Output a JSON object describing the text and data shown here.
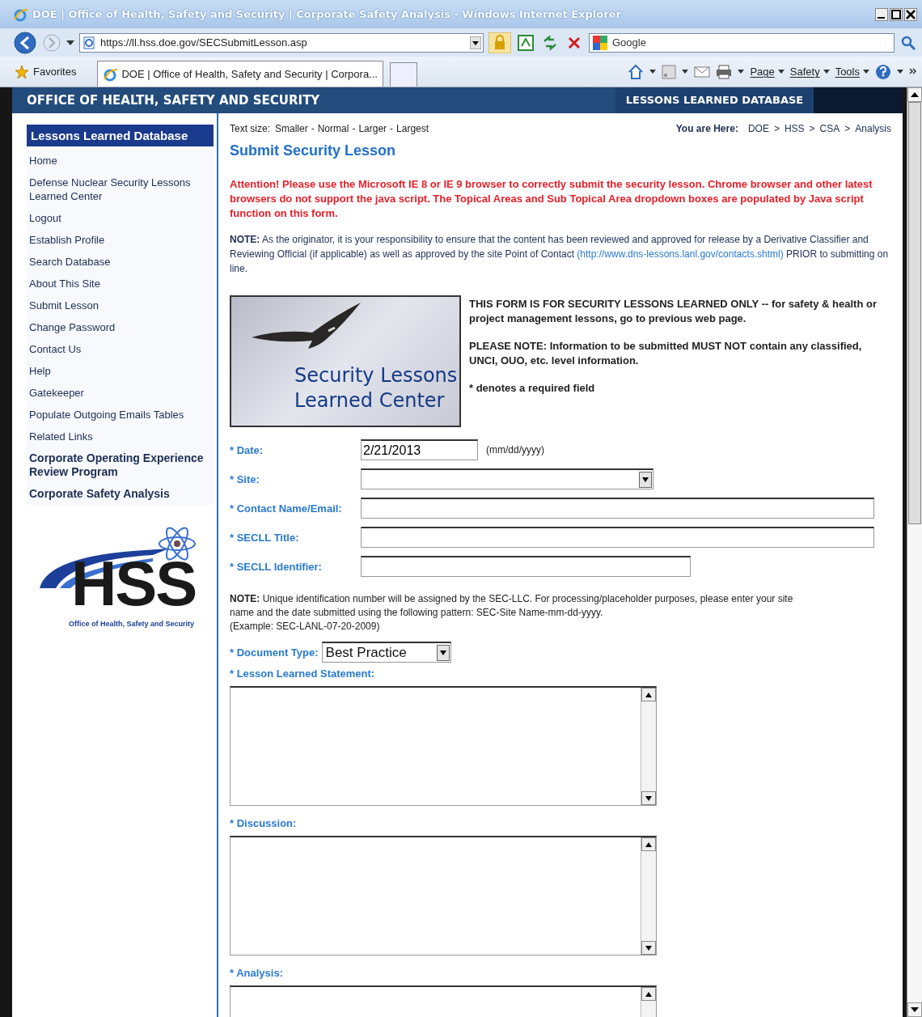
{
  "window": {
    "title": "DOE | Office of Health, Safety and Security | Corporate Safety Analysis - Windows Internet Explorer"
  },
  "address_bar": {
    "url": "https://ll.hss.doe.gov/SECSubmitLesson.asp",
    "search_value": "Google"
  },
  "favorites_bar": {
    "favorites": "Favorites",
    "tabs": [
      {
        "label": "DOE | Office of Health, Safety and Security | Corpora...",
        "selected": true
      }
    ],
    "commands": [
      "Page",
      "Safety",
      "Tools"
    ]
  },
  "header": {
    "title": "OFFICE OF HEALTH, SAFETY AND SECURITY",
    "section": "LESSONS LEARNED DATABASE"
  },
  "sidebar": {
    "heading": "Lessons Learned Database",
    "items": [
      {
        "label": "Home",
        "kind": "link"
      },
      {
        "label": "Defense Nuclear Security Lessons Learned Center",
        "kind": "link"
      },
      {
        "label": "Logout",
        "kind": "link"
      },
      {
        "label": "Establish Profile",
        "kind": "link"
      },
      {
        "label": "Search Database",
        "kind": "link"
      },
      {
        "label": "About This Site",
        "kind": "link"
      },
      {
        "label": "Submit Lesson",
        "kind": "link"
      },
      {
        "label": "Change Password",
        "kind": "link"
      },
      {
        "label": "Contact Us",
        "kind": "link"
      },
      {
        "label": "Help",
        "kind": "link"
      },
      {
        "label": "Gatekeeper",
        "kind": "link"
      },
      {
        "label": "Populate Outgoing Emails Tables",
        "kind": "link"
      },
      {
        "label": "Related Links",
        "kind": "link"
      },
      {
        "label": "Corporate Operating Experience Review Program",
        "kind": "major"
      },
      {
        "label": "Corporate Safety Analysis",
        "kind": "major"
      }
    ],
    "logo": {
      "text": "HSS",
      "caption": "Office of Health, Safety and Security"
    }
  },
  "main": {
    "text_size": {
      "label": "Text size:",
      "separator": "-",
      "options": [
        "Smaller",
        "Normal",
        "Larger",
        "Largest"
      ]
    },
    "breadcrumb": {
      "label": "You are Here:",
      "separator": ">",
      "items": [
        "DOE",
        "HSS",
        "CSA",
        "Analysis"
      ]
    },
    "title": "Submit Security Lesson",
    "attention": "Attention! Please use the Microsoft IE 8 or IE 9 browser to correctly submit the security lesson. Chrome browser and other latest browsers do not support the java script. The Topical Areas and Sub Topical Area dropdown boxes are populated by Java script function on this form.",
    "note": {
      "text": "**NOTE:** As the originator, it is your responsibility to ensure that the content has been reviewed and approved for release by a Derivative Classifier and Reviewing Official (if applicable) as well as approved by the site Point of Contact",
      "link": "(http://www.dns-lessons.lanl.gov/contacts.shtml)",
      "after": "PRIOR to submitting on line."
    },
    "banner": {
      "title": "Security Lessons Learned Center"
    },
    "info": [
      "THIS FORM IS FOR SECURITY LESSONS LEARNED ONLY -- for safety & health or project management lessons, go to previous web page.",
      "PLEASE NOTE: Information to be submitted MUST NOT contain any classified, UNCI, OUO, etc. level information.",
      "* denotes a required field"
    ],
    "fields": [
      {
        "kind": "text",
        "label": "* Date:",
        "value": "2/21/2013",
        "hint": "(mm/dd/yyyy)"
      },
      {
        "kind": "select",
        "label": "* Site:"
      },
      {
        "kind": "text",
        "label": "* Contact Name/Email:"
      },
      {
        "kind": "text",
        "label": "* SECLL Title:"
      },
      {
        "kind": "text",
        "label": "* SECLL Identifier:"
      }
    ],
    "id_note": [
      "**NOTE:** Unique identification number will be assigned by the SEC-LLC. For processing/placeholder purposes, please enter your site name and the date submitted using the following pattern: SEC-Site Name-mm-dd-yyyy.",
      "(Example: SEC-LANL-07-20-2009)"
    ],
    "document_type": {
      "label": "* Document Type:",
      "value": "Best Practice"
    },
    "text_areas": [
      {
        "label": "* Lesson Learned Statement:"
      },
      {
        "label": "* Discussion:"
      },
      {
        "label": "* Analysis:"
      }
    ]
  }
}
